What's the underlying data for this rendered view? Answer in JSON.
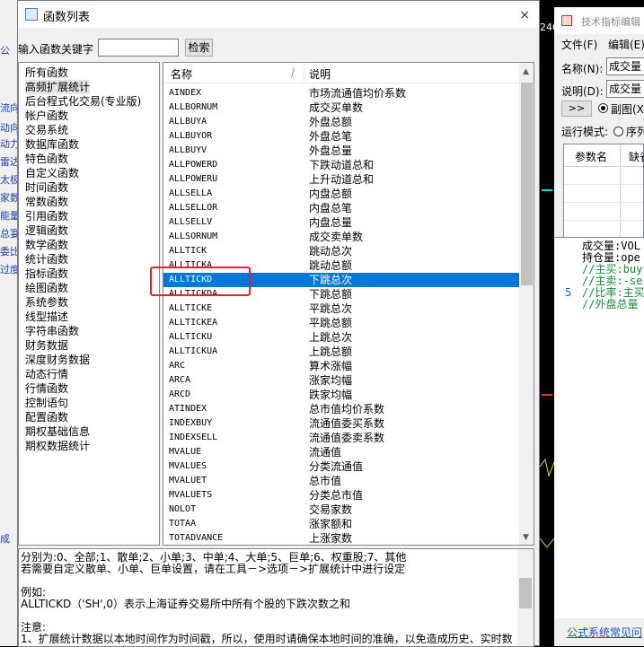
{
  "background": {
    "left_strip_labels": [
      "公",
      "流向",
      "动向",
      "动力",
      "雷达",
      "太极",
      "家数",
      "能量",
      "总宴",
      "委比",
      "过度",
      "成"
    ],
    "top_digits": "240"
  },
  "dialog": {
    "title": "函数列表",
    "close_icon": "×",
    "search_label": "输入函数关键字",
    "search_value": "",
    "search_button": "检索",
    "categories": [
      "所有函数",
      "高频扩展统计",
      "后台程式化交易(专业版)",
      "帐户函数",
      "交易系统",
      "数据库函数",
      "特色函数",
      "自定义函数",
      "时间函数",
      "常数函数",
      "引用函数",
      "逻辑函数",
      "数学函数",
      "统计函数",
      "指标函数",
      "绘图函数",
      "系统参数",
      "线型描述",
      "字符串函数",
      "财务数据",
      "深度财务数据",
      "动态行情",
      "行情函数",
      "控制语句",
      "配置函数",
      "期权基础信息",
      "期权数据统计"
    ],
    "selected_category_index": 1,
    "list_header": {
      "name": "名称",
      "desc": "说明",
      "sort_mark": "/"
    },
    "functions": [
      {
        "name": "AINDEX",
        "desc": "市场流通值均价系数"
      },
      {
        "name": "ALLBORNUM",
        "desc": "成交买单数"
      },
      {
        "name": "ALLBUYA",
        "desc": "外盘总额"
      },
      {
        "name": "ALLBUYOR",
        "desc": "外盘总笔"
      },
      {
        "name": "ALLBUYV",
        "desc": "外盘总量"
      },
      {
        "name": "ALLPOWERD",
        "desc": "下跌动道总和"
      },
      {
        "name": "ALLPOWERU",
        "desc": "上升动道总和"
      },
      {
        "name": "ALLSELLA",
        "desc": "内盘总额"
      },
      {
        "name": "ALLSELLOR",
        "desc": "内盘总笔"
      },
      {
        "name": "ALLSELLV",
        "desc": "内盘总量"
      },
      {
        "name": "ALLSORNUM",
        "desc": "成交卖单数"
      },
      {
        "name": "ALLTICK",
        "desc": "跳动总次"
      },
      {
        "name": "ALLTICKA",
        "desc": "跳动总额"
      },
      {
        "name": "ALLTICKD",
        "desc": "下跳总次"
      },
      {
        "name": "ALLTICKDA",
        "desc": "下跳总额"
      },
      {
        "name": "ALLTICKE",
        "desc": "平跳总次"
      },
      {
        "name": "ALLTICKEA",
        "desc": "平跳总额"
      },
      {
        "name": "ALLTICKU",
        "desc": "上跳总次"
      },
      {
        "name": "ALLTICKUA",
        "desc": "上跳总额"
      },
      {
        "name": "ARC",
        "desc": "算术涨幅"
      },
      {
        "name": "ARCA",
        "desc": "涨家均幅"
      },
      {
        "name": "ARCD",
        "desc": "跌家均幅"
      },
      {
        "name": "ATINDEX",
        "desc": "总市值均价系数"
      },
      {
        "name": "INDEXBUY",
        "desc": "流通值委买系数"
      },
      {
        "name": "INDEXSELL",
        "desc": "流通值委卖系数"
      },
      {
        "name": "MVALUE",
        "desc": "流通值"
      },
      {
        "name": "MVALUES",
        "desc": "分类流通值"
      },
      {
        "name": "MVALUET",
        "desc": "总市值"
      },
      {
        "name": "MVALUETS",
        "desc": "分类总市值"
      },
      {
        "name": "NOLOT",
        "desc": "交易家数"
      },
      {
        "name": "TOTAA",
        "desc": "涨家额和"
      },
      {
        "name": "TOTADVANCE",
        "desc": "上涨家数"
      }
    ],
    "selected_function_index": 13,
    "description_lines": [
      "分别为:0、全部;1、散单;2、小单;3、中单;4、大单;5、巨单;6、权重股;7、其他",
      "若需要自定义散单、小单、巨单设置，请在工具－>选项－>扩展统计中进行设定",
      "",
      "例如:",
      "ALLTICKD（'SH',0）表示上海证券交易所中所有个股的下跌次数之和",
      "",
      "注意:",
      "1、扩展统计数据以本地时间作为时间戳，所以，使用时请确保本地时间的准确，以免造成历史、实时数"
    ]
  },
  "editor": {
    "title": "技术指标编辑",
    "menu": [
      "文件(F)",
      "编辑(E)"
    ],
    "name_label": "名称(N):",
    "name_value": "成交量",
    "desc_label": "说明(D):",
    "desc_value": "成交量",
    "expand_button": ">>",
    "sub_chart_label": "副图(X",
    "run_mode_label": "运行模式:",
    "sequence_label": "序列",
    "param_header": [
      "参数名",
      "缺省"
    ],
    "code_lines": [
      "成交量:VOL",
      "持仓量:ope",
      "//主买:buy",
      "//主卖:-se",
      "//比率:主买",
      "//外盘总量"
    ],
    "line_number": "5",
    "help_link": "公式系统常见问"
  }
}
